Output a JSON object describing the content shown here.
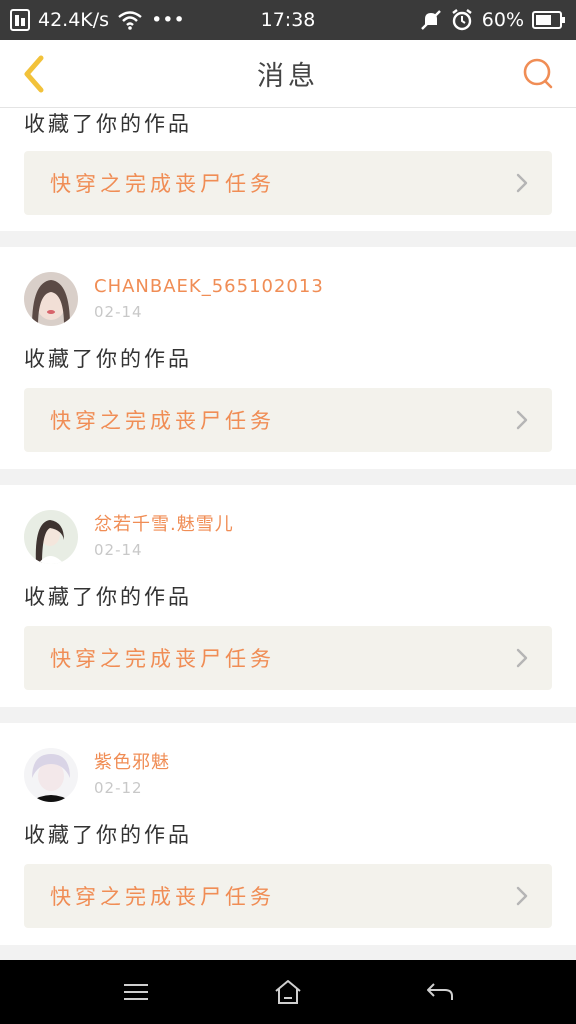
{
  "status_bar": {
    "network_speed": "42.4K/s",
    "more": "•••",
    "time": "17:38",
    "battery": "60%"
  },
  "header": {
    "title": "消息",
    "back_icon": "chevron-left-icon",
    "search_icon": "search-icon"
  },
  "messages": [
    {
      "action": "收藏了你的作品",
      "work_title": "快穿之完成丧尸任务"
    },
    {
      "username": "CHANBAEK_565102013",
      "date": "02-14",
      "action": "收藏了你的作品",
      "work_title": "快穿之完成丧尸任务"
    },
    {
      "username": "忿若千雪.魅雪儿",
      "date": "02-14",
      "action": "收藏了你的作品",
      "work_title": "快穿之完成丧尸任务"
    },
    {
      "username": "紫色邪魅",
      "date": "02-12",
      "action": "收藏了你的作品",
      "work_title": "快穿之完成丧尸任务"
    }
  ],
  "colors": {
    "accent": "#f08d55",
    "back_arrow": "#f2c23a",
    "status_bar": "#3a3a3a"
  }
}
